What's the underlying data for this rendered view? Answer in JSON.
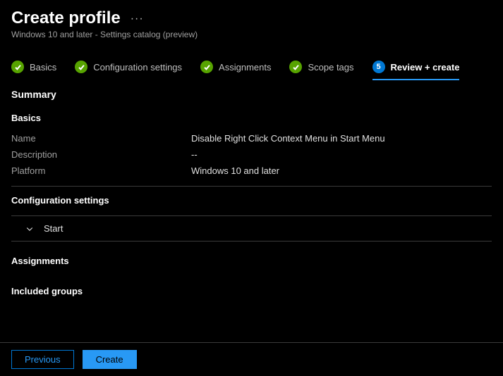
{
  "header": {
    "title": "Create profile",
    "subtitle": "Windows 10 and later - Settings catalog (preview)"
  },
  "wizard": {
    "steps": [
      {
        "label": "Basics",
        "status": "done"
      },
      {
        "label": "Configuration settings",
        "status": "done"
      },
      {
        "label": "Assignments",
        "status": "done"
      },
      {
        "label": "Scope tags",
        "status": "done"
      },
      {
        "label": "Review + create",
        "status": "current",
        "number": "5"
      }
    ]
  },
  "summary": {
    "heading": "Summary",
    "basics": {
      "heading": "Basics",
      "name_label": "Name",
      "name_value": "Disable Right Click Context Menu in Start Menu",
      "description_label": "Description",
      "description_value": "--",
      "platform_label": "Platform",
      "platform_value": "Windows 10 and later"
    },
    "config": {
      "heading": "Configuration settings",
      "group_label": "Start"
    },
    "assignments": {
      "heading": "Assignments",
      "included_heading": "Included groups"
    }
  },
  "footer": {
    "previous": "Previous",
    "create": "Create"
  }
}
